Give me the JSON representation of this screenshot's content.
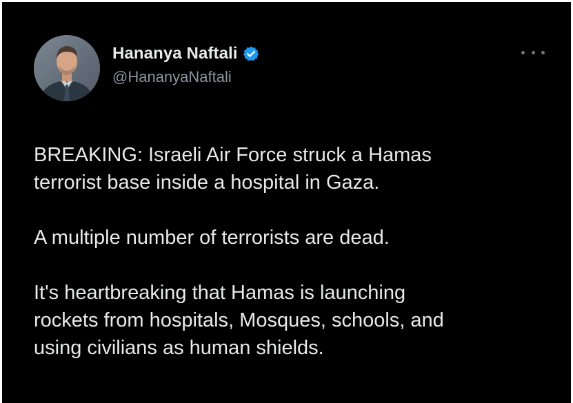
{
  "tweet": {
    "author": {
      "display_name": "Hananya Naftali",
      "handle": "@HananyaNaftali",
      "verified": true,
      "verified_icon": "verified-badge-icon",
      "avatar_icon": "avatar"
    },
    "more_icon": "more-options-icon",
    "paragraphs": [
      {
        "lines": [
          "BREAKING: Israeli Air Force struck a Hamas",
          "terrorist base inside a hospital in Gaza."
        ]
      },
      {
        "lines": [
          "A multiple number of terrorists are dead."
        ]
      },
      {
        "lines": [
          "It's heartbreaking that Hamas is launching",
          "rockets from hospitals, Mosques, schools, and",
          "using civilians as human shields."
        ]
      }
    ]
  },
  "colors": {
    "background": "#000000",
    "text": "#e7e9ea",
    "secondary_text": "#8b949e",
    "verified_blue": "#1d9bf0"
  }
}
